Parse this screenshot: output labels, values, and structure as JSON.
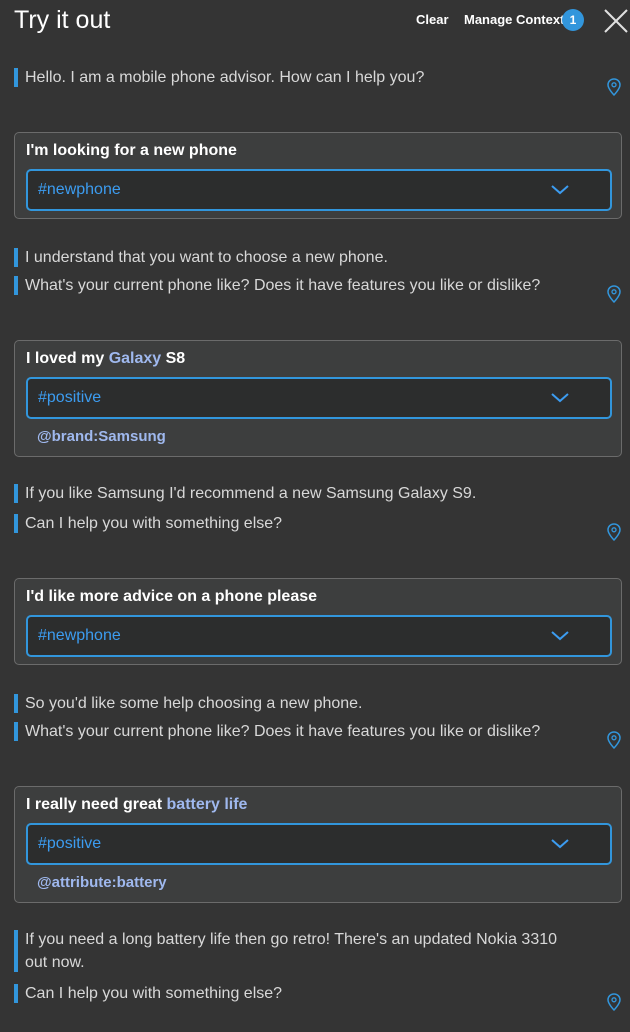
{
  "header": {
    "title": "Try it out",
    "clear_label": "Clear",
    "manage_context_label": "Manage Context",
    "context_count": "1"
  },
  "colors": {
    "accent": "#3296dc",
    "background": "#343434",
    "card": "#3d3e3e",
    "entity": "#9fb8ee"
  },
  "icons": {
    "close": "close-icon",
    "pin": "map-pin-icon",
    "dropdown": "chevron-down-icon"
  },
  "conversation": {
    "bot1": {
      "line1": "Hello. I am a mobile phone advisor. How can I help you?"
    },
    "user1": {
      "text": "I'm looking for a new phone",
      "intent": "#newphone"
    },
    "bot2": {
      "line1": "I understand that you want to choose a new phone.",
      "line2": "What's your current phone like? Does it have features you like or dislike?"
    },
    "user2": {
      "text_before": "I loved my ",
      "entity_text": "Galaxy",
      "text_after": " S8",
      "intent": "#positive",
      "entity": "@brand:Samsung"
    },
    "bot3": {
      "line1": "If you like Samsung I'd recommend a new Samsung Galaxy S9.",
      "line2": "Can I help you with something else?"
    },
    "user3": {
      "text": "I'd like more advice on a phone please",
      "intent": "#newphone"
    },
    "bot4": {
      "line1": "So you'd like some help choosing a new phone.",
      "line2": "What's your current phone like? Does it have features you like or dislike?"
    },
    "user4": {
      "text_before": "I really need great ",
      "entity_text": "battery life",
      "intent": "#positive",
      "entity": "@attribute:battery"
    },
    "bot5": {
      "line1a": "If you need a long battery life then go retro! There's an updated Nokia 3310",
      "line1b": "out now.",
      "line2": "Can I help you with something else?"
    }
  }
}
